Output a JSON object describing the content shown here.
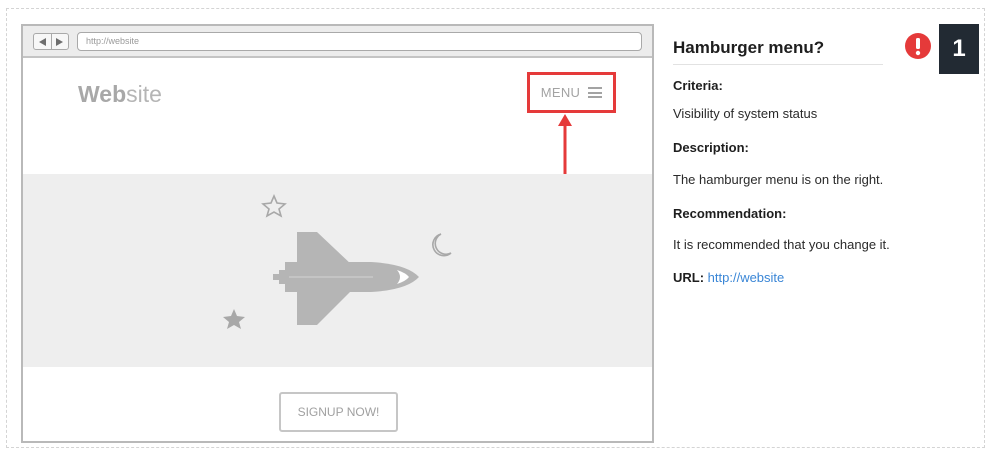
{
  "browser": {
    "url": "http://website",
    "site_logo_bold": "Web",
    "site_logo_rest": "site",
    "menu_label": "MENU",
    "signup_label": "SIGNUP NOW!"
  },
  "panel": {
    "title": "Hamburger menu?",
    "issue_number": "1",
    "criteria_label": "Criteria:",
    "criteria_value": "Visibility of system status",
    "description_label": "Description:",
    "description_value": "The hamburger menu is on the right.",
    "recommendation_label": "Recommendation:",
    "recommendation_value": "It is recommended that you change it.",
    "url_label": "URL:",
    "url_value": "http://website"
  },
  "colors": {
    "highlight": "#e53a3a",
    "alert": "#e53a3a",
    "link": "#3a86d6",
    "badge_bg": "#222a33"
  },
  "icons": [
    "back-arrow-icon",
    "forward-arrow-icon",
    "hamburger-icon",
    "star-outline-icon",
    "moon-icon",
    "star-filled-icon",
    "space-shuttle-icon",
    "alert-icon"
  ]
}
